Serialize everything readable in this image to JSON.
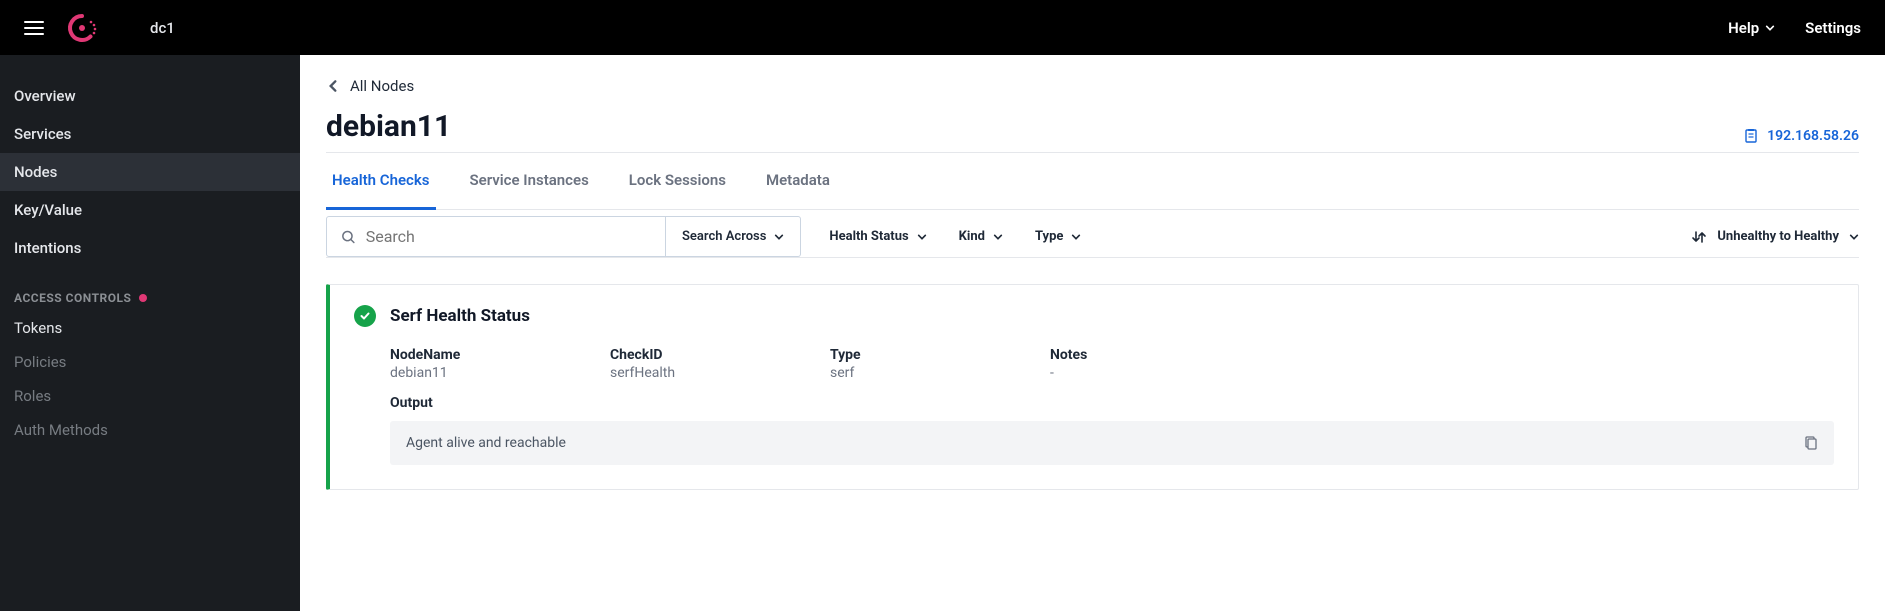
{
  "header": {
    "datacenter": "dc1",
    "help": "Help",
    "settings": "Settings"
  },
  "sidebar": {
    "items": [
      {
        "label": "Overview",
        "active": false
      },
      {
        "label": "Services",
        "active": false
      },
      {
        "label": "Nodes",
        "active": true
      },
      {
        "label": "Key/Value",
        "active": false
      },
      {
        "label": "Intentions",
        "active": false
      }
    ],
    "section_label": "ACCESS CONTROLS",
    "access": [
      {
        "label": "Tokens",
        "dim": false
      },
      {
        "label": "Policies",
        "dim": true
      },
      {
        "label": "Roles",
        "dim": true
      },
      {
        "label": "Auth Methods",
        "dim": true
      }
    ]
  },
  "breadcrumb": {
    "back": "All Nodes"
  },
  "page": {
    "title": "debian11",
    "ip": "192.168.58.26"
  },
  "tabs": {
    "items": [
      {
        "label": "Health Checks",
        "active": true
      },
      {
        "label": "Service Instances",
        "active": false
      },
      {
        "label": "Lock Sessions",
        "active": false
      },
      {
        "label": "Metadata",
        "active": false
      }
    ]
  },
  "filters": {
    "search_placeholder": "Search",
    "search_across": "Search Across",
    "health_status": "Health Status",
    "kind": "Kind",
    "type": "Type",
    "sort": "Unhealthy to Healthy"
  },
  "check": {
    "title": "Serf Health Status",
    "fields": {
      "nodename_label": "NodeName",
      "nodename_value": "debian11",
      "checkid_label": "CheckID",
      "checkid_value": "serfHealth",
      "type_label": "Type",
      "type_value": "serf",
      "notes_label": "Notes",
      "notes_value": "-"
    },
    "output_label": "Output",
    "output_value": "Agent alive and reachable"
  }
}
